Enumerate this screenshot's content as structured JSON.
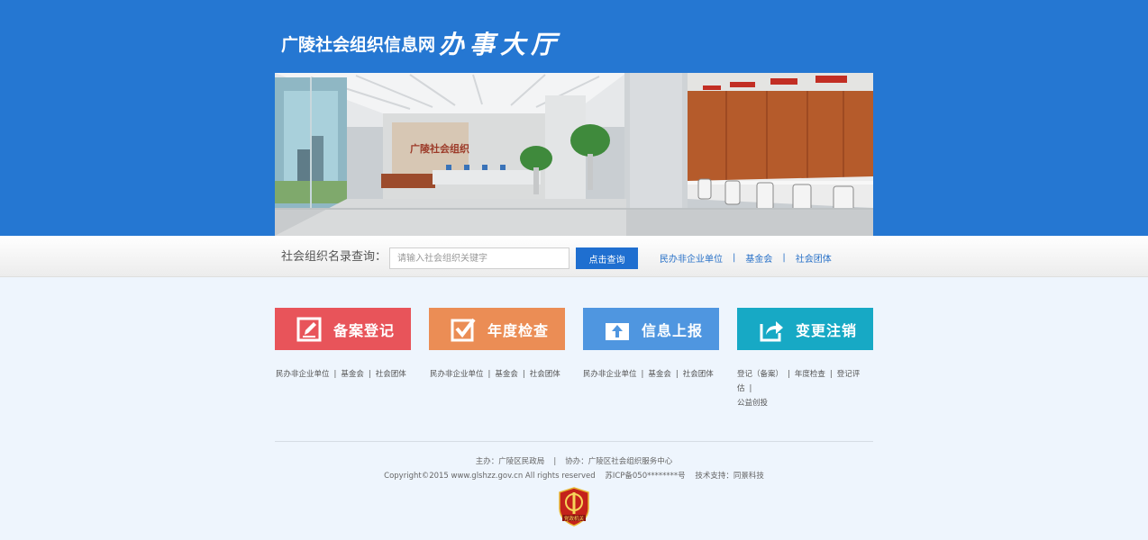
{
  "header": {
    "title_main": "广陵社会组织信息网",
    "title_calligraphy": "办事大厅"
  },
  "banner": {
    "wall_sign": "广陵社会组织"
  },
  "search": {
    "label": "社会组织名录查询：",
    "placeholder": "请输入社会组织关键字",
    "button": "点击查询",
    "links": [
      "民办非企业单位",
      "基金会",
      "社会团体"
    ]
  },
  "tiles": [
    {
      "label": "备案登记",
      "color": "#e8545a",
      "icon": "edit-icon",
      "links": [
        "民办非企业单位",
        "基金会",
        "社会团体"
      ]
    },
    {
      "label": "年度检查",
      "color": "#eb8d55",
      "icon": "checkbox-icon",
      "links": [
        "民办非企业单位",
        "基金会",
        "社会团体"
      ]
    },
    {
      "label": "信息上报",
      "color": "#4f96e0",
      "icon": "upload-icon",
      "links": [
        "民办非企业单位",
        "基金会",
        "社会团体"
      ]
    },
    {
      "label": "变更注销",
      "color": "#17a9c5",
      "icon": "share-icon",
      "links": [
        "登记（备案）",
        "年度检查",
        "登记评估",
        "公益创投"
      ]
    }
  ],
  "footer": {
    "host": "主办：广陵区民政局",
    "cohost": "协办：广陵区社会组织服务中心",
    "copyright": "Copyright©2015 www.glshzz.gov.cn  All rights reserved",
    "icp": "苏ICP备050********号",
    "tech": "技术支持：同景科技",
    "badge_text": "党政机关"
  }
}
